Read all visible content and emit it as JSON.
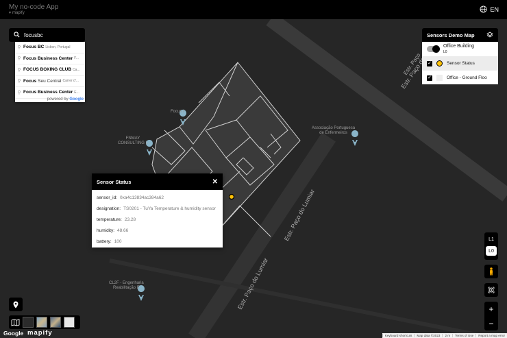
{
  "header": {
    "app_title": "My no-code App",
    "brand": "mapify",
    "language": "EN"
  },
  "search": {
    "value": "focusbc",
    "placeholder": ""
  },
  "suggestions": [
    {
      "bold": "Focus BC",
      "rest": "",
      "desc": "Lisbon, Portugal"
    },
    {
      "bold": "Focus Business Center",
      "rest": "",
      "desc": "F..."
    },
    {
      "bold": "FOCUS BOXING CLUB",
      "rest": "",
      "desc": "Ca..."
    },
    {
      "bold": "Focus",
      "rest": "Seu Central",
      "desc": "Carrer d'..."
    },
    {
      "bold": "Focus Business Center",
      "rest": "",
      "desc": "E..."
    }
  ],
  "powered_by": {
    "prefix": "powered by",
    "brand": "Google"
  },
  "layers_panel": {
    "title": "Sensors Demo Map",
    "building": {
      "name": "Office Building",
      "level": "L0"
    },
    "layers": [
      {
        "name": "Sensor Status"
      },
      {
        "name": "Office - Ground Floo"
      }
    ]
  },
  "popup": {
    "title": "Sensor Status",
    "rows": [
      {
        "key": "sensor_id:",
        "value": "0xa4c13834ac384a62"
      },
      {
        "key": "designation:",
        "value": "TS0201 - TuYa Temperature & humidity sensor"
      },
      {
        "key": "temperature:",
        "value": "23.28"
      },
      {
        "key": "humidity:",
        "value": "48.66"
      },
      {
        "key": "battery:",
        "value": "100"
      }
    ]
  },
  "map_labels": {
    "focus": "Focus I",
    "consulting_a": "FNMAY",
    "consulting_b": "CONSULTING L",
    "assoc_a": "Associação Portuguesa",
    "assoc_b": "de Enfermeiros",
    "cl2f_a": "CL2F - Engenharia",
    "cl2f_b": "Reabilitação E",
    "road_a": "Estr. Paço do Lumiar",
    "road_b": "Estr. Paço do Lumiar",
    "road_c": "Estr. Paço do Lumiar",
    "road_d": "Estr. Paço"
  },
  "levels": [
    "L1",
    "L0"
  ],
  "active_level": "L0",
  "zoom": {
    "in": "+",
    "out": "−"
  },
  "footer": {
    "google": "Google",
    "mapify": "mapify",
    "links": [
      "Keyboard shortcuts",
      "Map data ©2023",
      "2 m",
      "Terms of Use",
      "Report a map error"
    ]
  },
  "colors": {
    "accent": "#ffc107",
    "pin": "#8ab4c8",
    "building_line": "#d0d0d0"
  }
}
